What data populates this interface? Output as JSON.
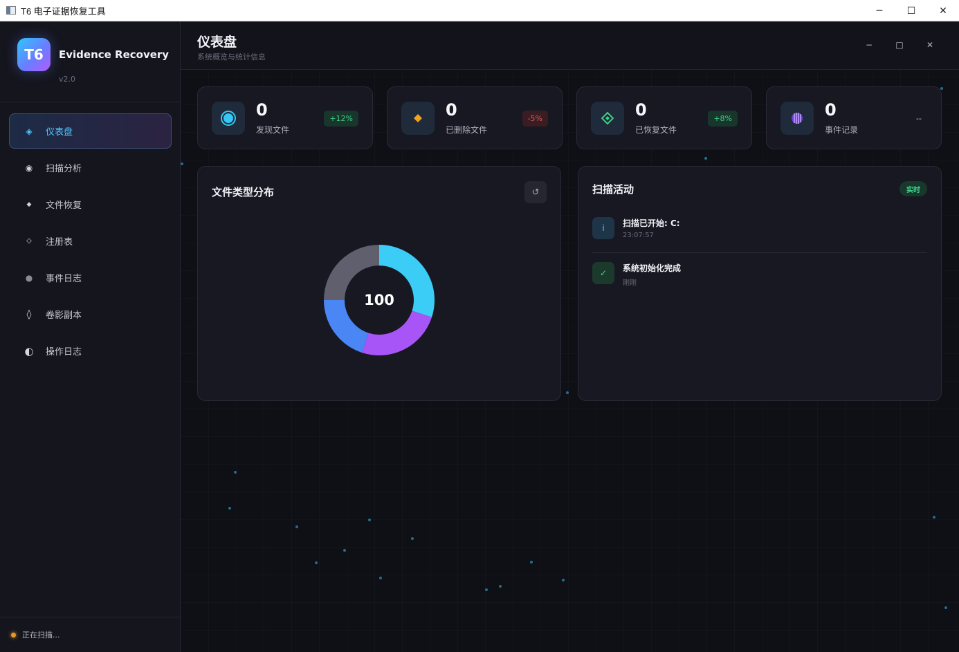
{
  "os_window": {
    "title": "T6 电子证据恢复工具",
    "minimize_glyph": "─",
    "maximize_glyph": "☐",
    "close_glyph": "✕"
  },
  "brand": {
    "logo_text": "T6",
    "name": "Evidence Recovery",
    "version": "v2.0"
  },
  "nav": {
    "items": [
      {
        "label": "仪表盘",
        "icon": "diamond-outline-icon",
        "glyph": "◈",
        "active": true
      },
      {
        "label": "扫描分析",
        "icon": "radio-scan-icon",
        "glyph": "◉",
        "active": false
      },
      {
        "label": "文件恢复",
        "icon": "small-diamond-icon",
        "glyph": "◆",
        "active": false
      },
      {
        "label": "注册表",
        "icon": "small-diamond-outline-icon",
        "glyph": "◇",
        "active": false
      },
      {
        "label": "事件日志",
        "icon": "filled-circle-icon",
        "glyph": "●",
        "active": false
      },
      {
        "label": "卷影副本",
        "icon": "tall-diamond-icon",
        "glyph": "◊",
        "active": false
      },
      {
        "label": "操作日志",
        "icon": "half-circle-icon",
        "glyph": "◐",
        "active": false
      }
    ]
  },
  "footer": {
    "status": "正在扫描..."
  },
  "header": {
    "title": "仪表盘",
    "subtitle": "系统概览与统计信息",
    "min_glyph": "−",
    "max_glyph": "□",
    "close_glyph": "✕"
  },
  "stats": [
    {
      "value": "0",
      "label": "发现文件",
      "badge": "+12%",
      "trend": "up",
      "icon": "target-icon",
      "color": "#35c8f5"
    },
    {
      "value": "0",
      "label": "已删除文件",
      "badge": "-5%",
      "trend": "down",
      "icon": "orange-diamond-icon",
      "color": "#f2a21b"
    },
    {
      "value": "0",
      "label": "已恢复文件",
      "badge": "+8%",
      "trend": "up",
      "icon": "green-diamond-icon",
      "color": "#3fcf86"
    },
    {
      "value": "0",
      "label": "事件记录",
      "badge": "--",
      "trend": "none",
      "icon": "purple-striped-circle-icon",
      "color": "#9a6cff"
    }
  ],
  "file_panel": {
    "title": "文件类型分布",
    "refresh_glyph": "↺",
    "center_value": "100"
  },
  "chart_data": {
    "type": "pie",
    "values": [
      30,
      25,
      20,
      25
    ],
    "colors": [
      "#3ccdf7",
      "#a855f7",
      "#4b86f5",
      "#5f5f6e"
    ],
    "total": 100
  },
  "activity_panel": {
    "title": "扫描活动",
    "badge": "实时",
    "items": [
      {
        "title": "扫描已开始: C:",
        "time": "23:07:57",
        "type": "info",
        "glyph": "i"
      },
      {
        "title": "系统初始化完成",
        "time": "刚刚",
        "type": "ok",
        "glyph": "✓"
      }
    ]
  }
}
